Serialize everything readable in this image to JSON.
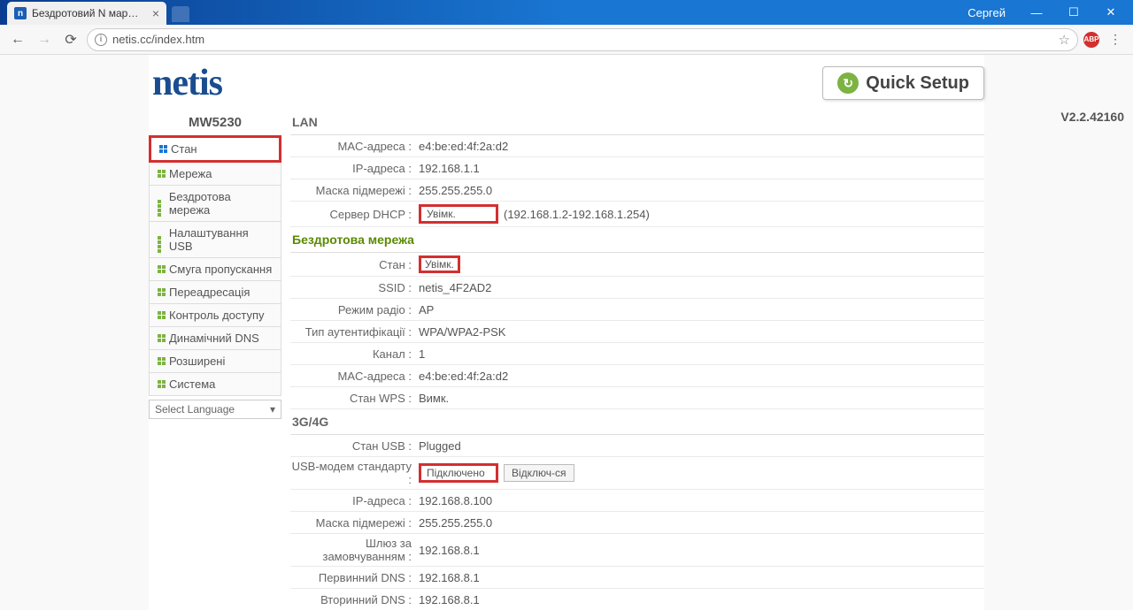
{
  "browser": {
    "tab_title": "Бездротовий N маршру",
    "url": "netis.cc/index.htm",
    "user": "Сергей"
  },
  "logo": "netis",
  "quick_setup": "Quick Setup",
  "model": "MW5230",
  "version": "V2.2.42160",
  "sidebar": {
    "items": [
      {
        "label": "Стан"
      },
      {
        "label": "Мережа"
      },
      {
        "label": "Бездротова мережа"
      },
      {
        "label": "Налаштування USB"
      },
      {
        "label": "Смуга пропускання"
      },
      {
        "label": "Переадресація"
      },
      {
        "label": "Контроль доступу"
      },
      {
        "label": "Динамічний DNS"
      },
      {
        "label": "Розширені"
      },
      {
        "label": "Система"
      }
    ],
    "lang_placeholder": "Select Language"
  },
  "sections": {
    "lan": {
      "title": "LAN",
      "mac_label": "MAC-адреса :",
      "mac": "e4:be:ed:4f:2a:d2",
      "ip_label": "IP-адреса :",
      "ip": "192.168.1.1",
      "mask_label": "Маска підмережі :",
      "mask": "255.255.255.0",
      "dhcp_label": "Сервер DHCP :",
      "dhcp_status": "Увімк.",
      "dhcp_range": "(192.168.1.2-192.168.1.254)"
    },
    "wireless": {
      "title": "Бездротова мережа",
      "state_label": "Стан :",
      "state": "Увімк.",
      "ssid_label": "SSID :",
      "ssid": "netis_4F2AD2",
      "radio_label": "Режим радіо :",
      "radio": "AP",
      "auth_label": "Тип аутентифікації :",
      "auth": "WPA/WPA2-PSK",
      "channel_label": "Канал :",
      "channel": "1",
      "mac_label": "MAC-адреса :",
      "mac": "e4:be:ed:4f:2a:d2",
      "wps_label": "Стан WPS :",
      "wps": "Вимк."
    },
    "g3g4": {
      "title": "3G/4G",
      "usb_label": "Стан USB :",
      "usb": "Plugged",
      "modem_label": "USB-модем стандарту :",
      "modem_status": "Підключено",
      "disconnect": "Відключ-ся",
      "ip_label": "IP-адреса :",
      "ip": "192.168.8.100",
      "mask_label": "Маска підмережі :",
      "mask": "255.255.255.0",
      "gw_label": "Шлюз за замовчуванням :",
      "gw": "192.168.8.1",
      "dns1_label": "Первинний DNS :",
      "dns1": "192.168.8.1",
      "dns2_label": "Вторинний DNS :",
      "dns2": "192.168.8.1"
    }
  }
}
